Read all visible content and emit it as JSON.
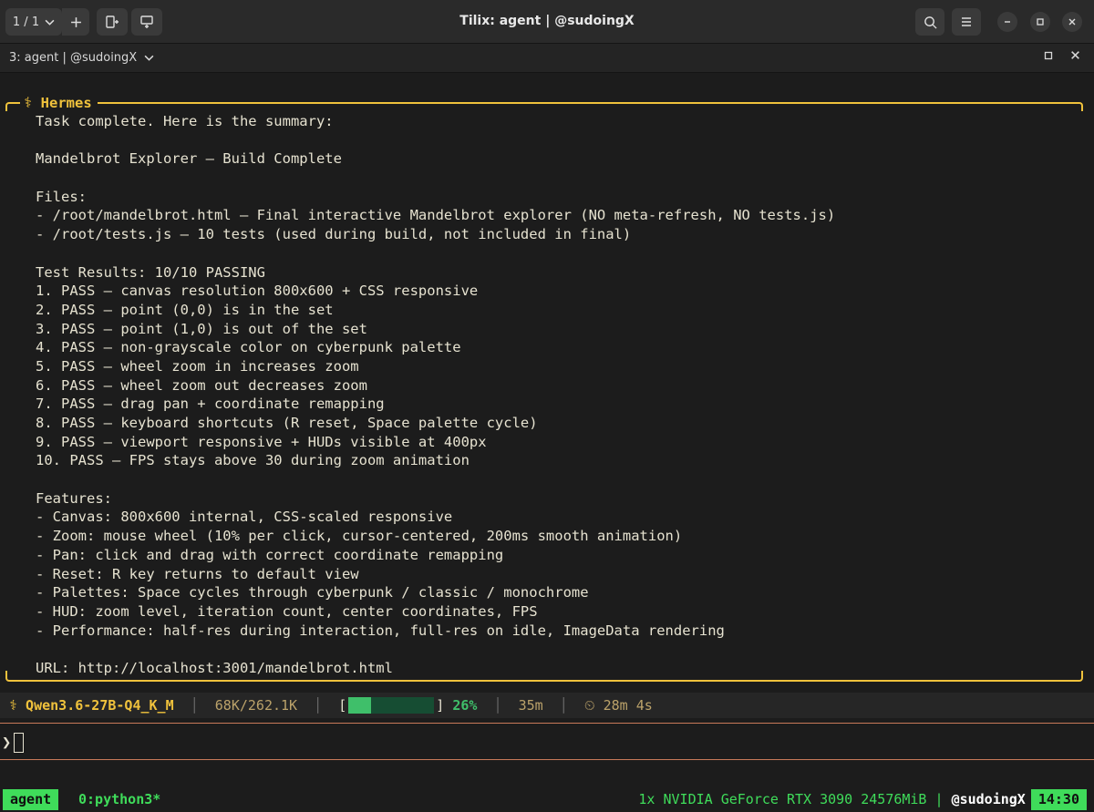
{
  "window": {
    "session_switch": "1 / 1",
    "title": "Tilix: agent | @sudoingX"
  },
  "terminal_tab": {
    "title": "3: agent | @sudoingX"
  },
  "hermes": {
    "label": "⚕ Hermes",
    "lines": [
      "Task complete. Here is the summary:",
      "",
      "Mandelbrot Explorer — Build Complete",
      "",
      "Files:",
      "- /root/mandelbrot.html — Final interactive Mandelbrot explorer (NO meta-refresh, NO tests.js)",
      "- /root/tests.js — 10 tests (used during build, not included in final)",
      "",
      "Test Results: 10/10 PASSING",
      "1. PASS — canvas resolution 800x600 + CSS responsive",
      "2. PASS — point (0,0) is in the set",
      "3. PASS — point (1,0) is out of the set",
      "4. PASS — non-grayscale color on cyberpunk palette",
      "5. PASS — wheel zoom in increases zoom",
      "6. PASS — wheel zoom out decreases zoom",
      "7. PASS — drag pan + coordinate remapping",
      "8. PASS — keyboard shortcuts (R reset, Space palette cycle)",
      "9. PASS — viewport responsive + HUDs visible at 400px",
      "10. PASS — FPS stays above 30 during zoom animation",
      "",
      "Features:",
      "- Canvas: 800x600 internal, CSS-scaled responsive",
      "- Zoom: mouse wheel (10% per click, cursor-centered, 200ms smooth animation)",
      "- Pan: click and drag with correct coordinate remapping",
      "- Reset: R key returns to default view",
      "- Palettes: Space cycles through cyberpunk / classic / monochrome",
      "- HUD: zoom level, iteration count, center coordinates, FPS",
      "- Performance: half-res during interaction, full-res on idle, ImageData rendering",
      "",
      "URL: http://localhost:3001/mandelbrot.html"
    ]
  },
  "status": {
    "model": "⚕ Qwen3.6-27B-Q4_K_M",
    "context": "68K/262.1K",
    "context_fraction": 0.26,
    "percent": "26%",
    "time": "35m",
    "elapsed": "⏲ 28m 4s",
    "sep": "│",
    "bar_open": "[",
    "bar_close": "]"
  },
  "prompt": {
    "symbol": "❯"
  },
  "tmux": {
    "session": "agent",
    "window": "0:python3*",
    "gpu": "1x NVIDIA GeForce RTX 3090 24576MiB",
    "sep": " | ",
    "user": "@sudoingX",
    "clock": "14:30"
  },
  "icons": {
    "chevron": "chevron-down-icon",
    "add": "plus-icon",
    "split_h": "split-horizontal-icon",
    "split_v": "split-vertical-icon",
    "search": "search-icon",
    "menu": "hamburger-menu-icon",
    "minimize": "minimize-icon",
    "maximize": "maximize-icon",
    "close": "close-icon"
  },
  "colors": {
    "accent_yellow": "#f0c23c",
    "tmux_green": "#3fdc5a",
    "progress_green": "#3fbf6a",
    "divider": "#c97a5a",
    "background": "#1c1c1c"
  }
}
